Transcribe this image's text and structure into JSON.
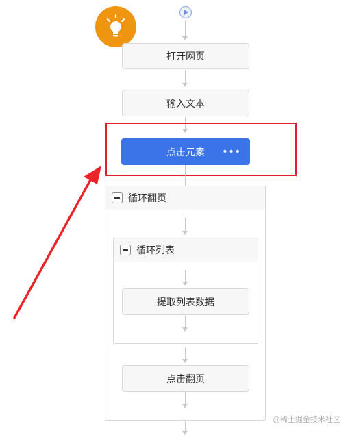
{
  "flow": {
    "nodes": [
      {
        "id": "open",
        "label": "打开网页"
      },
      {
        "id": "input",
        "label": "输入文本"
      },
      {
        "id": "click",
        "label": "点击元素",
        "selected": true
      },
      {
        "id": "extract",
        "label": "提取列表数据"
      },
      {
        "id": "next",
        "label": "点击翻页"
      }
    ],
    "loops": [
      {
        "id": "page-loop",
        "title": "循环翻页"
      },
      {
        "id": "list-loop",
        "title": "循环列表"
      }
    ],
    "more_icon": "ellipsis-icon",
    "start_icon": "play-circle-icon",
    "tip_icon": "lightbulb-icon"
  },
  "watermark": "@稀土掘金技术社区",
  "colors": {
    "primary": "#3b74e8",
    "highlight_box": "#e0202a",
    "arrow": "#ea2429",
    "tip_badge": "#f0950f",
    "connector": "#c8c8c8"
  }
}
